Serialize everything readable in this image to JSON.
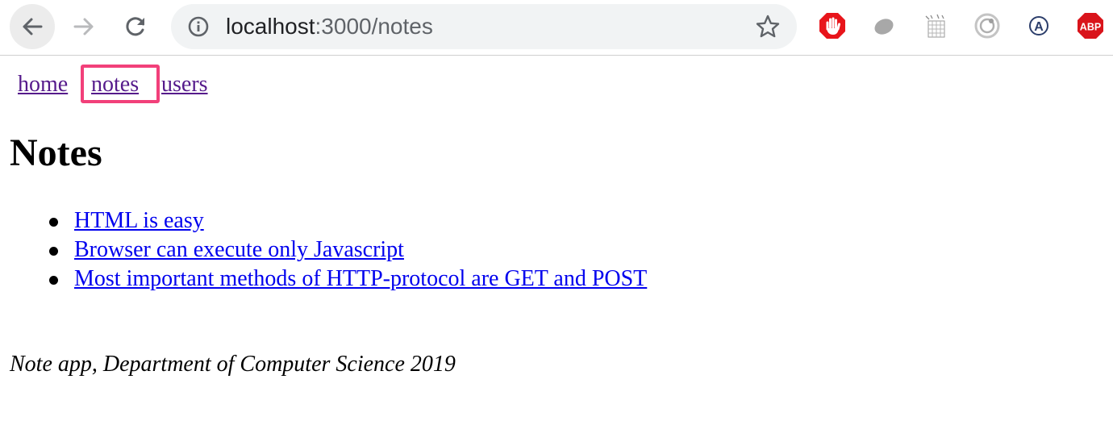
{
  "browser": {
    "url_host": "localhost",
    "url_rest": ":3000/notes",
    "icons": {
      "back": "arrow-left-icon",
      "forward": "arrow-right-icon",
      "reload": "reload-icon",
      "site_info": "info-circle-icon",
      "bookmark": "star-icon"
    },
    "extensions": [
      {
        "name": "adblock-hand-icon",
        "label": ""
      },
      {
        "name": "grey-blob-extension-icon",
        "label": ""
      },
      {
        "name": "grid-doc-extension-icon",
        "label": ""
      },
      {
        "name": "target-extension-icon",
        "label": ""
      },
      {
        "name": "circled-a-extension-icon",
        "label": "A"
      },
      {
        "name": "adblock-plus-icon",
        "label": "ABP"
      }
    ]
  },
  "nav": {
    "home": "home",
    "notes": "notes",
    "users": "users"
  },
  "page": {
    "title": "Notes",
    "notes": [
      "HTML is easy",
      "Browser can execute only Javascript",
      "Most important methods of HTTP-protocol are GET and POST"
    ],
    "footer": "Note app, Department of Computer Science 2019"
  },
  "colors": {
    "visited_link": "#551a8b",
    "link": "#0000ee",
    "highlight_box": "#f2407a",
    "omnibox_bg": "#f1f3f4",
    "adblock_red": "#e8151b"
  }
}
